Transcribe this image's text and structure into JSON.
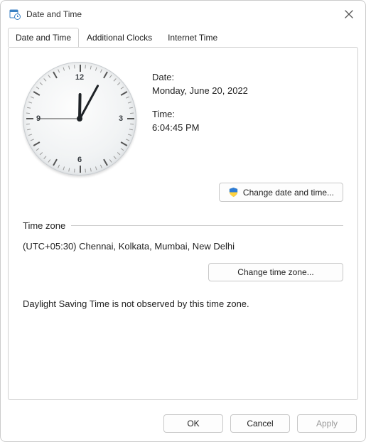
{
  "window": {
    "title": "Date and Time"
  },
  "tabs": {
    "date_time": "Date and Time",
    "additional_clocks": "Additional Clocks",
    "internet_time": "Internet Time"
  },
  "panel": {
    "date_label": "Date:",
    "date_value": "Monday, June 20, 2022",
    "time_label": "Time:",
    "time_value": "6:04:45 PM",
    "change_dt_button": "Change date and time...",
    "tz_section_header": "Time zone",
    "tz_value": "(UTC+05:30) Chennai, Kolkata, Mumbai, New Delhi",
    "change_tz_button": "Change time zone...",
    "dst_text": "Daylight Saving Time is not observed by this time zone."
  },
  "buttons": {
    "ok": "OK",
    "cancel": "Cancel",
    "apply": "Apply"
  },
  "clock": {
    "hour_angle": 1,
    "minute_angle": 28.5,
    "second_angle": 270
  }
}
